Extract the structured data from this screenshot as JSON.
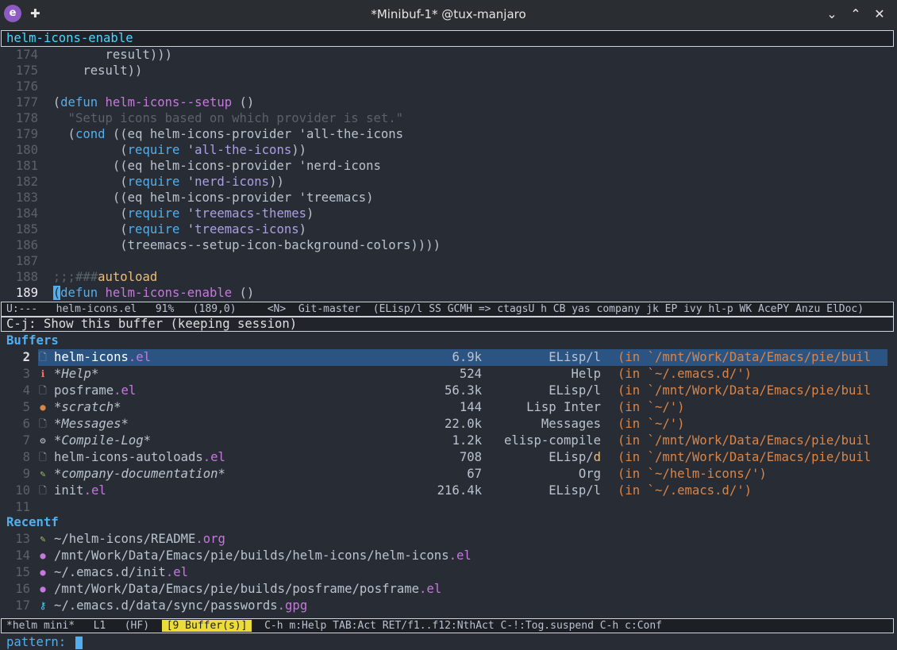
{
  "titlebar": {
    "title": "*Minibuf-1* @tux-manjaro",
    "app_icon": "emacs-icon"
  },
  "minibuffer_header": "helm-icons-enable",
  "code_lines": [
    {
      "n": "174",
      "segs": [
        {
          "t": "       result)))",
          "c": "paren"
        }
      ]
    },
    {
      "n": "175",
      "segs": [
        {
          "t": "    result))",
          "c": "paren"
        }
      ]
    },
    {
      "n": "176",
      "segs": []
    },
    {
      "n": "177",
      "segs": [
        {
          "t": "(",
          "c": "paren"
        },
        {
          "t": "defun",
          "c": "kw"
        },
        {
          "t": " ",
          "c": "paren"
        },
        {
          "t": "helm-icons--setup",
          "c": "fn"
        },
        {
          "t": " ()",
          "c": "paren"
        }
      ]
    },
    {
      "n": "178",
      "segs": [
        {
          "t": "  \"Setup icons based on which provider is set.\"",
          "c": "cm"
        }
      ]
    },
    {
      "n": "179",
      "segs": [
        {
          "t": "  (",
          "c": "paren"
        },
        {
          "t": "cond",
          "c": "kw"
        },
        {
          "t": " ((eq helm-icons-provider '",
          "c": "paren"
        },
        {
          "t": "all-the-icons",
          "c": "paren"
        }
      ]
    },
    {
      "n": "180",
      "segs": [
        {
          "t": "         (",
          "c": "paren"
        },
        {
          "t": "require",
          "c": "kw"
        },
        {
          "t": " '",
          "c": "paren"
        },
        {
          "t": "all-the-icons",
          "c": "qt"
        },
        {
          "t": "))",
          "c": "paren"
        }
      ]
    },
    {
      "n": "181",
      "segs": [
        {
          "t": "        ((eq helm-icons-provider '",
          "c": "paren"
        },
        {
          "t": "nerd-icons",
          "c": "paren"
        }
      ]
    },
    {
      "n": "182",
      "segs": [
        {
          "t": "         (",
          "c": "paren"
        },
        {
          "t": "require",
          "c": "kw"
        },
        {
          "t": " '",
          "c": "paren"
        },
        {
          "t": "nerd-icons",
          "c": "qt"
        },
        {
          "t": "))",
          "c": "paren"
        }
      ]
    },
    {
      "n": "183",
      "segs": [
        {
          "t": "        ((eq helm-icons-provider '",
          "c": "paren"
        },
        {
          "t": "treemacs",
          "c": "paren"
        },
        {
          "t": ")",
          "c": "paren"
        }
      ]
    },
    {
      "n": "184",
      "segs": [
        {
          "t": "         (",
          "c": "paren"
        },
        {
          "t": "require",
          "c": "kw"
        },
        {
          "t": " '",
          "c": "paren"
        },
        {
          "t": "treemacs-themes",
          "c": "qt"
        },
        {
          "t": ")",
          "c": "paren"
        }
      ]
    },
    {
      "n": "185",
      "segs": [
        {
          "t": "         (",
          "c": "paren"
        },
        {
          "t": "require",
          "c": "kw"
        },
        {
          "t": " '",
          "c": "paren"
        },
        {
          "t": "treemacs-icons",
          "c": "qt"
        },
        {
          "t": ")",
          "c": "paren"
        }
      ]
    },
    {
      "n": "186",
      "segs": [
        {
          "t": "         (treemacs--setup-icon-background-colors))))",
          "c": "paren"
        }
      ]
    },
    {
      "n": "187",
      "segs": []
    },
    {
      "n": "188",
      "segs": [
        {
          "t": ";;;###",
          "c": "cm"
        },
        {
          "t": "autoload",
          "c": "cm2"
        }
      ]
    },
    {
      "n": "189",
      "cur": true,
      "segs": [
        {
          "t": "(",
          "c": "cursor"
        },
        {
          "t": "defun",
          "c": "kw"
        },
        {
          "t": " ",
          "c": "paren"
        },
        {
          "t": "helm-icons-enable",
          "c": "fn"
        },
        {
          "t": " ()",
          "c": "paren"
        }
      ]
    }
  ],
  "modeline": "U:---   helm-icons.el   91%   (189,0)     <N>  Git-master  (ELisp/l SS GCMH => ctagsU h CB yas company jk EP ivy hl-p WK AcePY Anzu ElDoc)",
  "helm_header": "C-j: Show this buffer (keeping session)",
  "sections": {
    "buffers": "Buffers",
    "recentf": "Recentf"
  },
  "buffers": [
    {
      "n": "2",
      "icon": "file-icon",
      "base": "helm-icons",
      "ext": ".el",
      "italic": false,
      "size": "6.9k",
      "mode": "ELisp/l",
      "path": "(in `/mnt/Work/Data/Emacs/pie/buil",
      "sel": true
    },
    {
      "n": "3",
      "icon": "info-icon",
      "base": "*Help*",
      "ext": "",
      "italic": true,
      "size": "524",
      "mode": "Help",
      "path": "(in `~/.emacs.d/')"
    },
    {
      "n": "4",
      "icon": "file-icon",
      "base": "posframe",
      "ext": ".el",
      "italic": false,
      "size": "56.3k",
      "mode": "ELisp/l",
      "path": "(in `/mnt/Work/Data/Emacs/pie/buil"
    },
    {
      "n": "5",
      "icon": "scratch-icon",
      "base": "*scratch*",
      "ext": "",
      "italic": true,
      "size": "144",
      "mode": "Lisp Inter",
      "path": "(in `~/')"
    },
    {
      "n": "6",
      "icon": "file-icon",
      "base": "*Messages*",
      "ext": "",
      "italic": true,
      "size": "22.0k",
      "mode": "Messages",
      "path": "(in `~/')"
    },
    {
      "n": "7",
      "icon": "gears-icon",
      "base": "*Compile-Log*",
      "ext": "",
      "italic": true,
      "size": "1.2k",
      "mode": "elisp-compile",
      "path": "(in `/mnt/Work/Data/Emacs/pie/buil"
    },
    {
      "n": "8",
      "icon": "file-icon",
      "base": "helm-icons-autoloads",
      "ext": ".el",
      "italic": false,
      "size": "708",
      "mode": "ELisp/d",
      "path": "(in `/mnt/Work/Data/Emacs/pie/buil"
    },
    {
      "n": "9",
      "icon": "org-icon",
      "base": "*company-documentation*",
      "ext": "",
      "italic": true,
      "size": "67",
      "mode": "Org",
      "path": "(in `~/helm-icons/')"
    },
    {
      "n": "10",
      "icon": "file-icon",
      "base": "init",
      "ext": ".el",
      "italic": false,
      "size": "216.4k",
      "mode": "ELisp/l",
      "path": "(in `~/.emacs.d/')"
    },
    {
      "n": "11",
      "icon": "",
      "base": "",
      "ext": "",
      "italic": false,
      "size": "",
      "mode": "",
      "path": ""
    }
  ],
  "recentf": [
    {
      "n": "13",
      "icon": "org-icon",
      "base": "~/helm-icons/README",
      "ext": ".org"
    },
    {
      "n": "14",
      "icon": "elisp-icon",
      "base": "/mnt/Work/Data/Emacs/pie/builds/helm-icons/helm-icons",
      "ext": ".el"
    },
    {
      "n": "15",
      "icon": "elisp-icon",
      "base": "~/.emacs.d/init",
      "ext": ".el"
    },
    {
      "n": "16",
      "icon": "elisp-icon",
      "base": "/mnt/Work/Data/Emacs/pie/builds/posframe/posframe",
      "ext": ".el"
    },
    {
      "n": "17",
      "icon": "key-icon",
      "base": "~/.emacs.d/data/sync/passwords",
      "ext": ".gpg"
    }
  ],
  "helm_modeline": {
    "name": "*helm mini*",
    "pos": "L1",
    "hf": "(HF)",
    "count": "[9 Buffer(s)]",
    "keys": "C-h m:Help TAB:Act RET/f1..f12:NthAct C-!:Tog.suspend C-h c:Conf"
  },
  "minibuffer": {
    "prompt": "pattern:"
  },
  "colors": {
    "accent": "#51afef",
    "selection": "#2b5483",
    "path": "#da8548",
    "ext": "#c678dd",
    "badge": "#ecdc3b"
  }
}
